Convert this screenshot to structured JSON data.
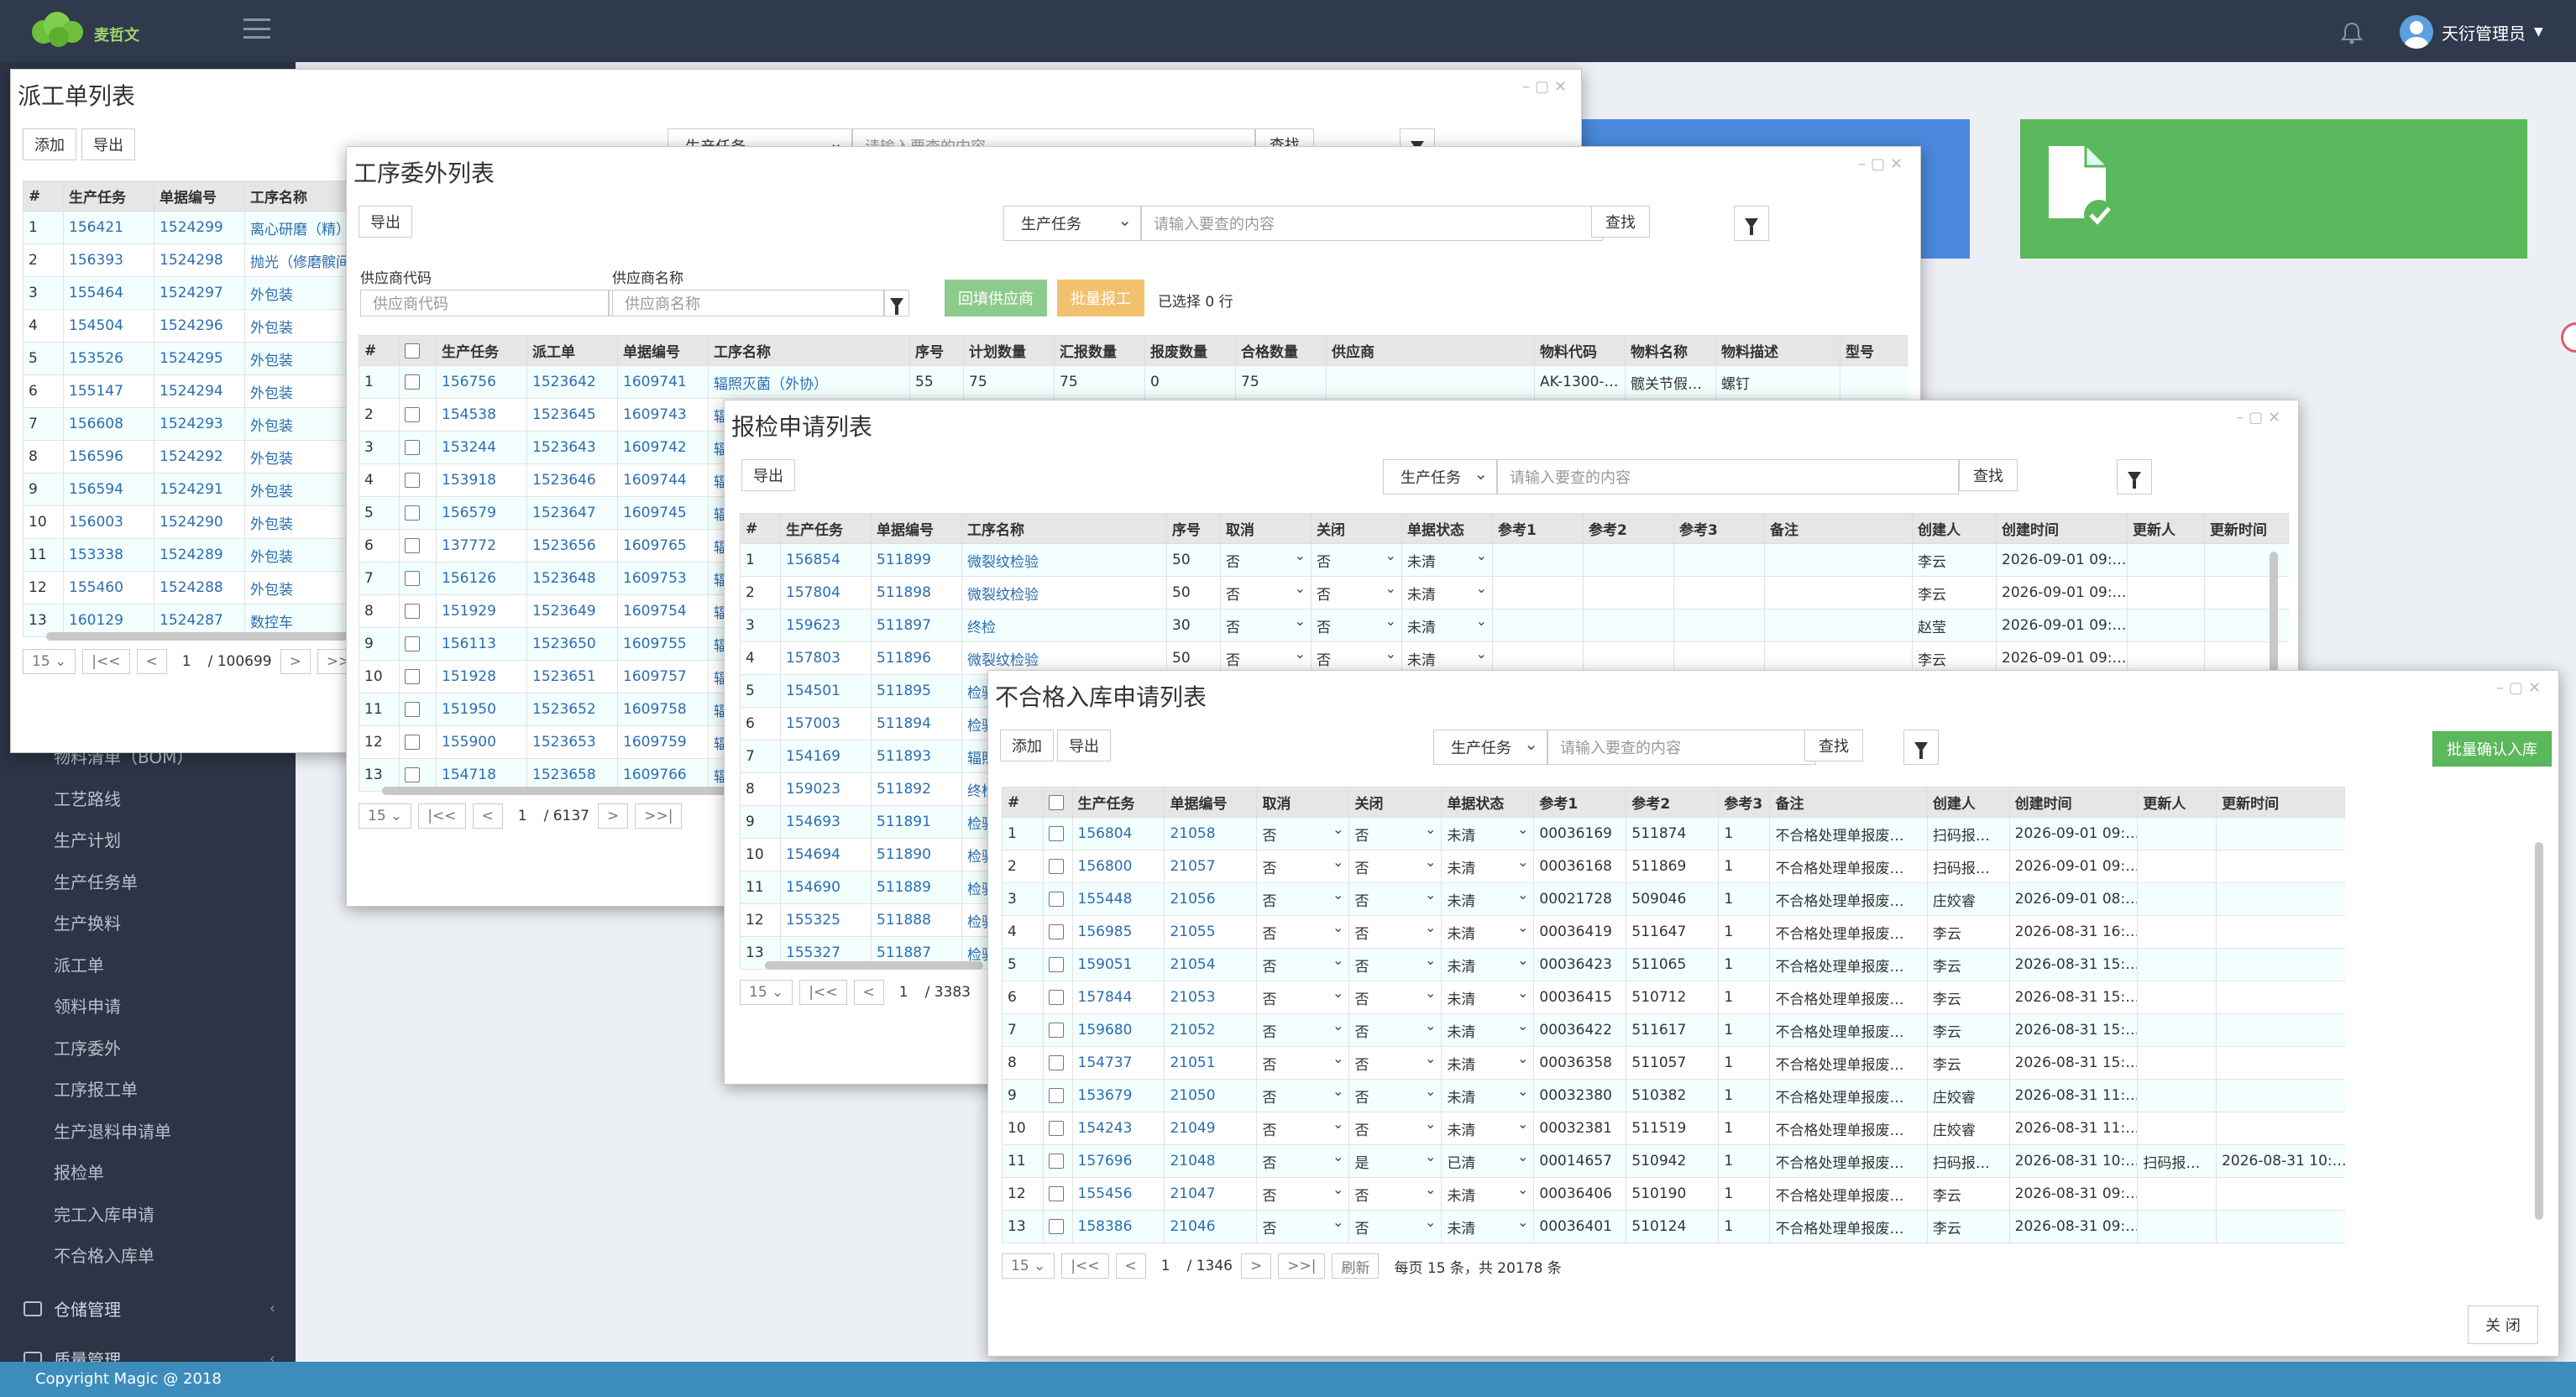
{
  "app": {
    "logo_text": "麦哲文",
    "user_name": "天衍管理员",
    "footer": "Copyright Magic @ 2018"
  },
  "sidebar": {
    "items": [
      "物料清单（BOM）",
      "工艺路线",
      "生产计划",
      "生产任务单",
      "生产换料",
      "派工单",
      "领料申请",
      "工序委外",
      "工序报工单",
      "生产退料申请单",
      "报检单",
      "完工入库申请",
      "不合格入库单"
    ],
    "sections": [
      "仓储管理",
      "质量管理"
    ]
  },
  "win1": {
    "title": "派工单列表",
    "add": "添加",
    "export": "导出",
    "select": "生产任务",
    "placeholder": "请输入要查的内容",
    "search": "查找",
    "headers": [
      "#",
      "生产任务",
      "单据编号",
      "工序名称"
    ],
    "rows": [
      [
        "1",
        "156421",
        "1524299",
        "离心研磨（精）"
      ],
      [
        "2",
        "156393",
        "1524298",
        "抛光（修磨髌间）"
      ],
      [
        "3",
        "155464",
        "1524297",
        "外包装"
      ],
      [
        "4",
        "154504",
        "1524296",
        "外包装"
      ],
      [
        "5",
        "153526",
        "1524295",
        "外包装"
      ],
      [
        "6",
        "155147",
        "1524294",
        "外包装"
      ],
      [
        "7",
        "156608",
        "1524293",
        "外包装"
      ],
      [
        "8",
        "156596",
        "1524292",
        "外包装"
      ],
      [
        "9",
        "156594",
        "1524291",
        "外包装"
      ],
      [
        "10",
        "156003",
        "1524290",
        "外包装"
      ],
      [
        "11",
        "153338",
        "1524289",
        "外包装"
      ],
      [
        "12",
        "155460",
        "1524288",
        "外包装"
      ],
      [
        "13",
        "160129",
        "1524287",
        "数控车"
      ]
    ],
    "pager": {
      "size": "15",
      "first": "|<<",
      "prev": "<",
      "page": "1",
      "total": "/ 100699",
      "next": ">",
      "last": ">>|"
    }
  },
  "win2": {
    "title": "工序委外列表",
    "export": "导出",
    "select": "生产任务",
    "placeholder": "请输入要查的内容",
    "search": "查找",
    "f1_label": "供应商代码",
    "f1_ph": "供应商代码",
    "f2_label": "供应商名称",
    "f2_ph": "供应商名称",
    "btn_fill": "回填供应商",
    "btn_batch": "批量报工",
    "selected": "已选择 0 行",
    "headers": [
      "#",
      "",
      "生产任务",
      "派工单",
      "单据编号",
      "工序名称",
      "序号",
      "计划数量",
      "汇报数量",
      "报废数量",
      "合格数量",
      "供应商",
      "物料代码",
      "物料名称",
      "物料描述",
      "型号"
    ],
    "rows": [
      [
        "1",
        "",
        "156756",
        "1523642",
        "1609741",
        "辐照灭菌（外协）",
        "55",
        "75",
        "75",
        "0",
        "75",
        "",
        "AK-1300-…",
        "髋关节假…",
        "螺钉",
        ""
      ],
      [
        "2",
        "",
        "154538",
        "1523645",
        "1609743",
        "辐",
        "",
        "",
        "",
        "",
        "",
        "",
        "",
        "",
        "",
        ""
      ],
      [
        "3",
        "",
        "153244",
        "1523643",
        "1609742",
        "辐",
        "",
        "",
        "",
        "",
        "",
        "",
        "",
        "",
        "",
        ""
      ],
      [
        "4",
        "",
        "153918",
        "1523646",
        "1609744",
        "辐",
        "",
        "",
        "",
        "",
        "",
        "",
        "",
        "",
        "",
        ""
      ],
      [
        "5",
        "",
        "156579",
        "1523647",
        "1609745",
        "辐",
        "",
        "",
        "",
        "",
        "",
        "",
        "",
        "",
        "",
        ""
      ],
      [
        "6",
        "",
        "137772",
        "1523656",
        "1609765",
        "辐",
        "",
        "",
        "",
        "",
        "",
        "",
        "",
        "",
        "",
        ""
      ],
      [
        "7",
        "",
        "156126",
        "1523648",
        "1609753",
        "辐",
        "",
        "",
        "",
        "",
        "",
        "",
        "",
        "",
        "",
        ""
      ],
      [
        "8",
        "",
        "151929",
        "1523649",
        "1609754",
        "辐",
        "",
        "",
        "",
        "",
        "",
        "",
        "",
        "",
        "",
        ""
      ],
      [
        "9",
        "",
        "156113",
        "1523650",
        "1609755",
        "辐",
        "",
        "",
        "",
        "",
        "",
        "",
        "",
        "",
        "",
        ""
      ],
      [
        "10",
        "",
        "151928",
        "1523651",
        "1609757",
        "辐",
        "",
        "",
        "",
        "",
        "",
        "",
        "",
        "",
        "",
        ""
      ],
      [
        "11",
        "",
        "151950",
        "1523652",
        "1609758",
        "辐",
        "",
        "",
        "",
        "",
        "",
        "",
        "",
        "",
        "",
        ""
      ],
      [
        "12",
        "",
        "155900",
        "1523653",
        "1609759",
        "辐",
        "",
        "",
        "",
        "",
        "",
        "",
        "",
        "",
        "",
        ""
      ],
      [
        "13",
        "",
        "154718",
        "1523658",
        "1609766",
        "辐",
        "",
        "",
        "",
        "",
        "",
        "",
        "",
        "",
        "",
        ""
      ]
    ],
    "pager": {
      "size": "15",
      "first": "|<<",
      "prev": "<",
      "page": "1",
      "total": "/  6137",
      "next": ">",
      "last": ">>|"
    }
  },
  "win3": {
    "title": "报检申请列表",
    "export": "导出",
    "select": "生产任务",
    "placeholder": "请输入要查的内容",
    "search": "查找",
    "headers": [
      "#",
      "生产任务",
      "单据编号",
      "工序名称",
      "序号",
      "取消",
      "关闭",
      "单据状态",
      "参考1",
      "参考2",
      "参考3",
      "备注",
      "创建人",
      "创建时间",
      "更新人",
      "更新时间"
    ],
    "rows": [
      [
        "1",
        "156854",
        "511899",
        "微裂纹检验",
        "50",
        "否",
        "否",
        "未清",
        "",
        "",
        "",
        "",
        "李云",
        "2026-09-01 09:…",
        "",
        ""
      ],
      [
        "2",
        "157804",
        "511898",
        "微裂纹检验",
        "50",
        "否",
        "否",
        "未清",
        "",
        "",
        "",
        "",
        "李云",
        "2026-09-01 09:…",
        "",
        ""
      ],
      [
        "3",
        "159623",
        "511897",
        "终检",
        "30",
        "否",
        "否",
        "未清",
        "",
        "",
        "",
        "",
        "赵莹",
        "2026-09-01 09:…",
        "",
        ""
      ],
      [
        "4",
        "157803",
        "511896",
        "微裂纹检验",
        "50",
        "否",
        "否",
        "未清",
        "",
        "",
        "",
        "",
        "李云",
        "2026-09-01 09:…",
        "",
        ""
      ],
      [
        "5",
        "154501",
        "511895",
        "检验",
        "",
        "",
        "",
        "",
        "",
        "",
        "",
        "",
        "",
        "",
        "",
        ""
      ],
      [
        "6",
        "157003",
        "511894",
        "检验",
        "",
        "",
        "",
        "",
        "",
        "",
        "",
        "",
        "",
        "",
        "",
        ""
      ],
      [
        "7",
        "154169",
        "511893",
        "辐照",
        "",
        "",
        "",
        "",
        "",
        "",
        "",
        "",
        "",
        "",
        "",
        ""
      ],
      [
        "8",
        "159023",
        "511892",
        "终检",
        "",
        "",
        "",
        "",
        "",
        "",
        "",
        "",
        "",
        "",
        "",
        ""
      ],
      [
        "9",
        "154693",
        "511891",
        "检验",
        "",
        "",
        "",
        "",
        "",
        "",
        "",
        "",
        "",
        "",
        "",
        ""
      ],
      [
        "10",
        "154694",
        "511890",
        "检验",
        "",
        "",
        "",
        "",
        "",
        "",
        "",
        "",
        "",
        "",
        "",
        ""
      ],
      [
        "11",
        "154690",
        "511889",
        "检验",
        "",
        "",
        "",
        "",
        "",
        "",
        "",
        "",
        "",
        "",
        "",
        ""
      ],
      [
        "12",
        "155325",
        "511888",
        "检验",
        "",
        "",
        "",
        "",
        "",
        "",
        "",
        "",
        "",
        "",
        "",
        ""
      ],
      [
        "13",
        "155327",
        "511887",
        "检验",
        "",
        "",
        "",
        "",
        "",
        "",
        "",
        "",
        "",
        "",
        "",
        ""
      ]
    ],
    "pager": {
      "size": "15",
      "first": "|<<",
      "prev": "<",
      "page": "1",
      "total": "/  3383"
    }
  },
  "win4": {
    "title": "不合格入库申请列表",
    "add": "添加",
    "export": "导出",
    "select": "生产任务",
    "placeholder": "请输入要查的内容",
    "search": "查找",
    "batch": "批量确认入库",
    "close": "关 闭",
    "headers": [
      "#",
      "",
      "生产任务",
      "单据编号",
      "取消",
      "关闭",
      "单据状态",
      "参考1",
      "参考2",
      "参考3",
      "备注",
      "创建人",
      "创建时间",
      "更新人",
      "更新时间"
    ],
    "rows": [
      [
        "1",
        "",
        "156804",
        "21058",
        "否",
        "否",
        "未清",
        "00036169",
        "511874",
        "1",
        "不合格处理单报废…",
        "扫码报…",
        "2026-09-01 09:…",
        "",
        ""
      ],
      [
        "2",
        "",
        "156800",
        "21057",
        "否",
        "否",
        "未清",
        "00036168",
        "511869",
        "1",
        "不合格处理单报废…",
        "扫码报…",
        "2026-09-01 09:…",
        "",
        ""
      ],
      [
        "3",
        "",
        "155448",
        "21056",
        "否",
        "否",
        "未清",
        "00021728",
        "509046",
        "1",
        "不合格处理单报废…",
        "庄姣睿",
        "2026-09-01 08:…",
        "",
        ""
      ],
      [
        "4",
        "",
        "156985",
        "21055",
        "否",
        "否",
        "未清",
        "00036419",
        "511647",
        "1",
        "不合格处理单报废…",
        "李云",
        "2026-08-31 16:…",
        "",
        ""
      ],
      [
        "5",
        "",
        "159051",
        "21054",
        "否",
        "否",
        "未清",
        "00036423",
        "511065",
        "1",
        "不合格处理单报废…",
        "李云",
        "2026-08-31 15:…",
        "",
        ""
      ],
      [
        "6",
        "",
        "157844",
        "21053",
        "否",
        "否",
        "未清",
        "00036415",
        "510712",
        "1",
        "不合格处理单报废…",
        "李云",
        "2026-08-31 15:…",
        "",
        ""
      ],
      [
        "7",
        "",
        "159680",
        "21052",
        "否",
        "否",
        "未清",
        "00036422",
        "511617",
        "1",
        "不合格处理单报废…",
        "李云",
        "2026-08-31 15:…",
        "",
        ""
      ],
      [
        "8",
        "",
        "154737",
        "21051",
        "否",
        "否",
        "未清",
        "00036358",
        "511057",
        "1",
        "不合格处理单报废…",
        "李云",
        "2026-08-31 15:…",
        "",
        ""
      ],
      [
        "9",
        "",
        "153679",
        "21050",
        "否",
        "否",
        "未清",
        "00032380",
        "510382",
        "1",
        "不合格处理单报废…",
        "庄姣睿",
        "2026-08-31 11:…",
        "",
        ""
      ],
      [
        "10",
        "",
        "154243",
        "21049",
        "否",
        "否",
        "未清",
        "00032381",
        "511519",
        "1",
        "不合格处理单报废…",
        "庄姣睿",
        "2026-08-31 11:…",
        "",
        ""
      ],
      [
        "11",
        "",
        "157696",
        "21048",
        "否",
        "是",
        "已清",
        "00014657",
        "510942",
        "1",
        "不合格处理单报废…",
        "扫码报…",
        "2026-08-31 10:…",
        "扫码报…",
        "2026-08-31 10:…"
      ],
      [
        "12",
        "",
        "155456",
        "21047",
        "否",
        "否",
        "未清",
        "00036406",
        "510190",
        "1",
        "不合格处理单报废…",
        "李云",
        "2026-08-31 09:…",
        "",
        ""
      ],
      [
        "13",
        "",
        "158386",
        "21046",
        "否",
        "否",
        "未清",
        "00036401",
        "510124",
        "1",
        "不合格处理单报废…",
        "李云",
        "2026-08-31 09:…",
        "",
        ""
      ]
    ],
    "pager": {
      "size": "15",
      "first": "|<<",
      "prev": "<",
      "page": "1",
      "total": "/  1346",
      "next": ">",
      "last": ">>|",
      "refresh": "刷新",
      "summary": "每页 15 条，共 20178 条"
    }
  }
}
